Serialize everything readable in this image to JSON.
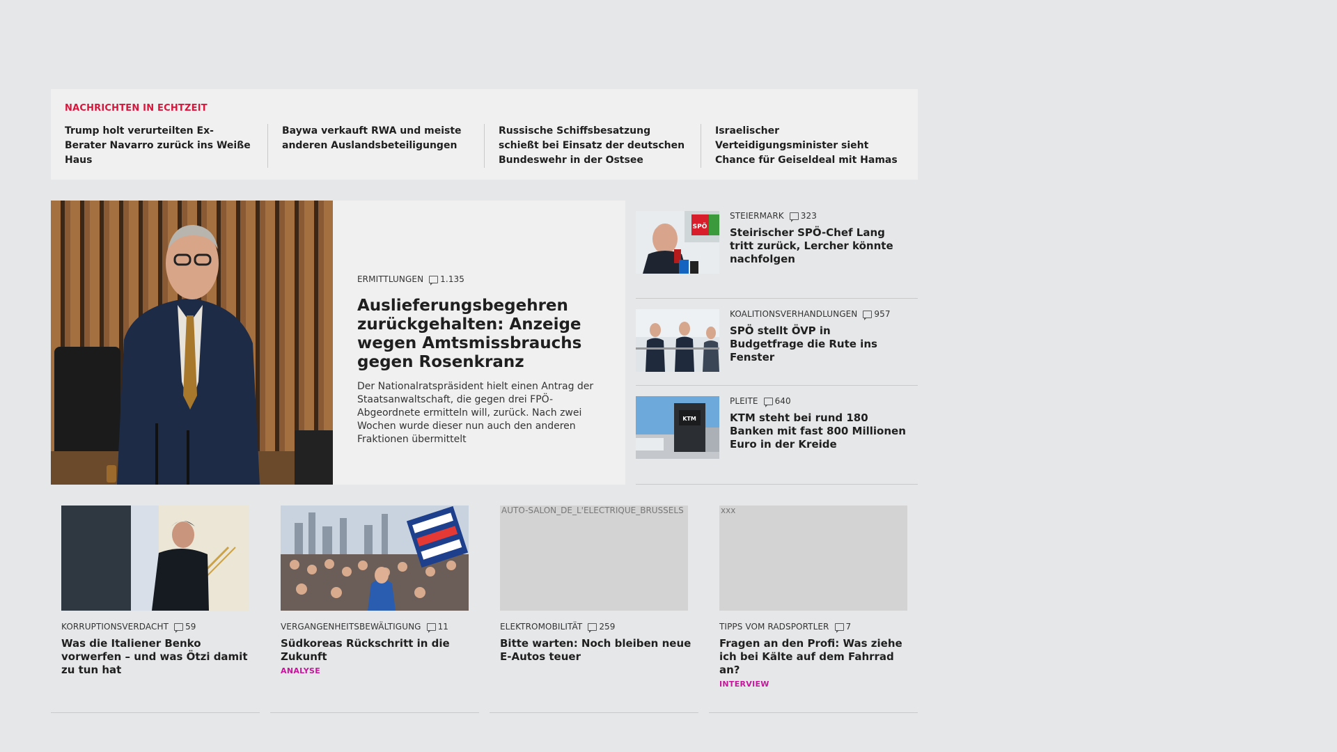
{
  "ticker": {
    "title": "NACHRICHTEN IN ECHTZEIT",
    "items": [
      "Trump holt verurteilten Ex-Berater Navarro zurück ins Weiße Haus",
      "Baywa verkauft RWA und meiste anderen Auslandsbeteiligungen",
      "Russische Schiffsbesatzung schießt bei Einsatz der deutschen Bundeswehr in der Ostsee",
      "Israelischer Verteidigungsminister sieht Chance für Geiseldeal mit Hamas"
    ]
  },
  "lead": {
    "category": "ERMITTLUNGEN",
    "comments": "1.135",
    "headline": "Auslieferungsbegehren zurückgehalten: Anzeige wegen Amtsmissbrauchs gegen Rosenkranz",
    "teaser": "Der Nationalratspräsident hielt einen Antrag der Staatsanwaltschaft, die gegen drei FPÖ-Abgeordnete ermitteln will, zurück. Nach zwei Wochen wurde dieser nun auch den anderen Fraktionen übermittelt"
  },
  "side": [
    {
      "category": "STEIERMARK",
      "comments": "323",
      "headline": "Steirischer SPÖ-Chef Lang tritt zurück, Lercher könnte nachfolgen",
      "image_text": "SPÖ"
    },
    {
      "category": "KOALITIONSVERHANDLUNGEN",
      "comments": "957",
      "headline": "SPÖ stellt ÖVP in Budgetfrage die Rute ins Fenster"
    },
    {
      "category": "PLEITE",
      "comments": "640",
      "headline": "KTM steht bei rund 180 Banken mit fast 800 Millionen Euro in der Kreide",
      "image_text": "KTM"
    }
  ],
  "cards": [
    {
      "category": "KORRUPTIONSVERDACHT",
      "comments": "59",
      "headline": "Was die Italiener Benko vorwerfen – und was Ötzi damit zu tun hat",
      "tag": ""
    },
    {
      "category": "VERGANGENHEITSBEWÄLTIGUNG",
      "comments": "11",
      "headline": "Südkoreas Rückschritt in die Zukunft",
      "tag": "ANALYSE"
    },
    {
      "category": "ELEKTROMOBILITÄT",
      "comments": "259",
      "headline": "Bitte warten: Noch bleiben neue E-Autos teuer",
      "tag": "",
      "alt": "AUTO-SALON_DE_L'ELECTRIQUE_BRUSSELS"
    },
    {
      "category": "TIPPS VOM RADSPORTLER",
      "comments": "7",
      "headline": "Fragen an den Profi: Was ziehe ich bei Kälte auf dem Fahrrad an?",
      "tag": "INTERVIEW",
      "alt": "xxx"
    }
  ],
  "colors": {
    "background": "#e6e7e8",
    "panel": "#f0f0f0",
    "ticker_title": "#d8173c",
    "tag": "#c4179b"
  }
}
